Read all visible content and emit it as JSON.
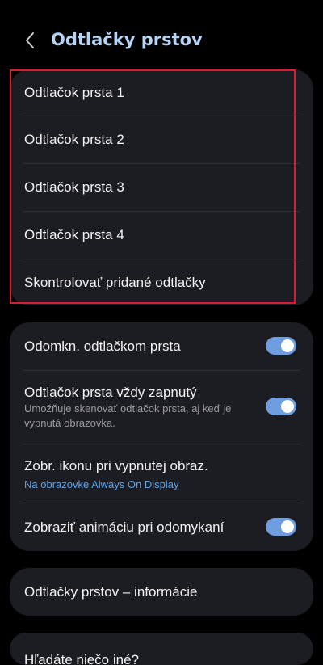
{
  "header": {
    "title": "Odtlačky prstov",
    "back_icon": "chevron-left-icon"
  },
  "fingerprints": {
    "items": [
      {
        "label": "Odtlačok prsta 1"
      },
      {
        "label": "Odtlačok prsta 2"
      },
      {
        "label": "Odtlačok prsta 3"
      },
      {
        "label": "Odtlačok prsta 4"
      },
      {
        "label": "Skontrolovať pridané odtlačky"
      }
    ]
  },
  "settings": {
    "unlock": {
      "label": "Odomkn. odtlačkom prsta",
      "on": true
    },
    "always_on": {
      "label": "Odtlačok prsta vždy zapnutý",
      "description": "Umožňuje skenovať odtlačok prsta, aj keď je vypnutá obrazovka.",
      "on": true
    },
    "show_icon": {
      "label": "Zobr. ikonu pri vypnutej obraz.",
      "value": "Na obrazovke Always On Display"
    },
    "animation": {
      "label": "Zobraziť animáciu pri odomykaní",
      "on": true
    }
  },
  "info": {
    "label": "Odtlačky prstov – informácie"
  },
  "next_section": {
    "label": "Hľadáte niečo iné?"
  },
  "colors": {
    "background": "#000000",
    "card": "#1c1d22",
    "title": "#b6d4f6",
    "toggle_on": "#6f9ee0",
    "link": "#5aa4f0",
    "highlight": "#d9202a"
  }
}
